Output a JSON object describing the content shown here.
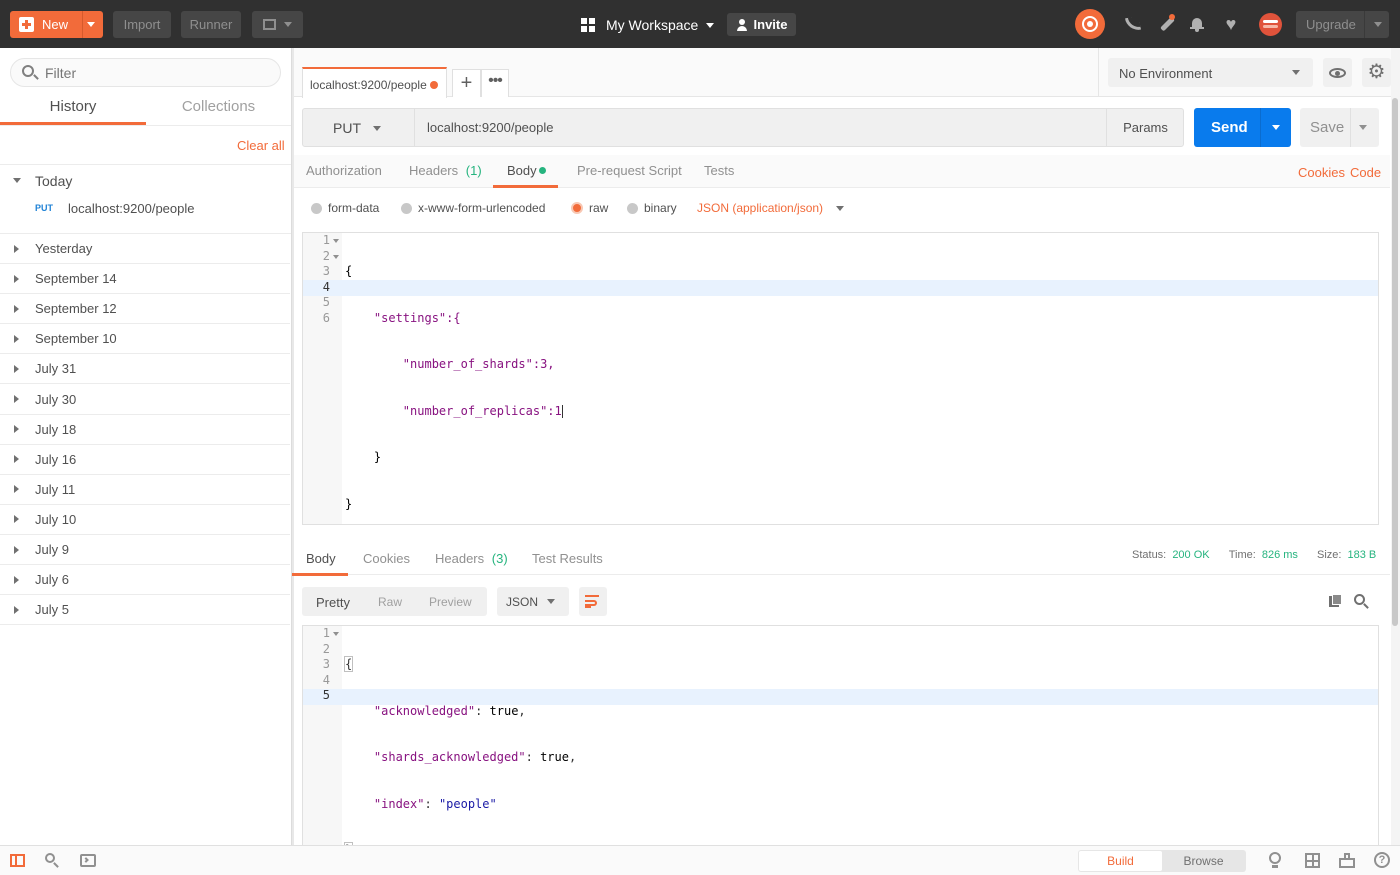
{
  "topbar": {
    "new_label": "New",
    "import_label": "Import",
    "runner_label": "Runner",
    "workspace_label": "My Workspace",
    "invite_label": "Invite",
    "upgrade_label": "Upgrade"
  },
  "sidebar": {
    "filter_placeholder": "Filter",
    "tabs": [
      "History",
      "Collections"
    ],
    "clear_all": "Clear all",
    "today": {
      "label": "Today",
      "items": [
        {
          "method": "PUT",
          "url": "localhost:9200/people"
        }
      ]
    },
    "groups": [
      "Yesterday",
      "September 14",
      "September 12",
      "September 10",
      "July 31",
      "July 30",
      "July 18",
      "July 16",
      "July 11",
      "July 10",
      "July 9",
      "July 6",
      "July 5"
    ]
  },
  "request_tab": {
    "label": "localhost:9200/people"
  },
  "environment": {
    "label": "No Environment"
  },
  "request": {
    "method": "PUT",
    "url": "localhost:9200/people",
    "params_label": "Params",
    "send_label": "Send",
    "save_label": "Save"
  },
  "request_tabs": {
    "authorization": "Authorization",
    "headers": "Headers",
    "headers_count": "(1)",
    "body": "Body",
    "prerequest": "Pre-request Script",
    "tests": "Tests",
    "cookies": "Cookies",
    "code": "Code"
  },
  "body_types": {
    "form_data": "form-data",
    "urlencoded": "x-www-form-urlencoded",
    "raw": "raw",
    "binary": "binary",
    "content_type": "JSON (application/json)"
  },
  "request_body": {
    "line_numbers": [
      "1",
      "2",
      "3",
      "4",
      "5",
      "6"
    ],
    "lines": [
      "{",
      "    \"settings\":{",
      "        \"number_of_shards\":3,",
      "        \"number_of_replicas\":1",
      "    }",
      "}"
    ]
  },
  "response_tabs": {
    "body": "Body",
    "cookies": "Cookies",
    "headers": "Headers",
    "headers_count": "(3)",
    "test_results": "Test Results"
  },
  "response_status": {
    "status_label": "Status:",
    "status_value": "200 OK",
    "time_label": "Time:",
    "time_value": "826 ms",
    "size_label": "Size:",
    "size_value": "183 B"
  },
  "response_view": {
    "pretty": "Pretty",
    "raw": "Raw",
    "preview": "Preview",
    "format": "JSON"
  },
  "response_body": {
    "line_numbers": [
      "1",
      "2",
      "3",
      "4",
      "5"
    ],
    "key_acknowledged": "\"acknowledged\"",
    "val_acknowledged": "true",
    "key_shards": "\"shards_acknowledged\"",
    "val_shards": "true",
    "key_index": "\"index\"",
    "val_index": "\"people\""
  },
  "statusbar": {
    "build": "Build",
    "browse": "Browse"
  },
  "colors": {
    "accent": "#f26b3a",
    "send": "#097bed",
    "status_ok": "#26b47f",
    "topbar": "#303030"
  }
}
